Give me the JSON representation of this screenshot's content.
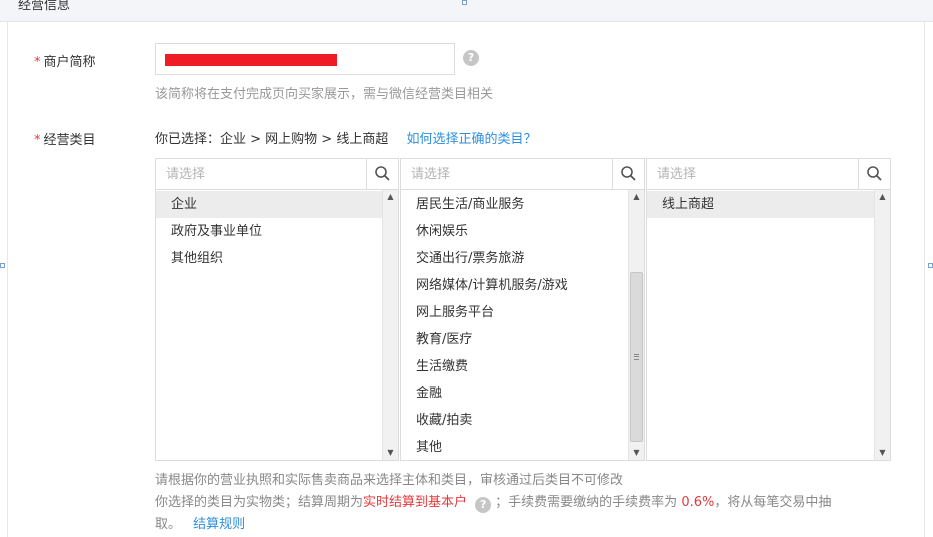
{
  "section": {
    "title": "经营信息"
  },
  "merchant_name": {
    "label": "商户简称",
    "required_mark": "*",
    "hint": "该简称将在支付完成页向买家展示，需与微信经营类目相关",
    "help": "?"
  },
  "category": {
    "label": "经营类目",
    "required_mark": "*",
    "selected_prefix": "你已选择：",
    "selected_path": "企业 > 网上购物 > 线上商超",
    "help_link": "如何选择正确的类目？",
    "columns": [
      {
        "placeholder": "请选择",
        "items": [
          "企业",
          "政府及事业单位",
          "其他组织"
        ],
        "selected": "企业"
      },
      {
        "placeholder": "请选择",
        "items": [
          "居民生活/商业服务",
          "休闲娱乐",
          "交通出行/票务旅游",
          "网络媒体/计算机服务/游戏",
          "网上服务平台",
          "教育/医疗",
          "生活缴费",
          "金融",
          "收藏/拍卖",
          "其他"
        ],
        "scroll_position": 0.75
      },
      {
        "placeholder": "请选择",
        "items": [
          "线上商超"
        ],
        "selected": "线上商超"
      }
    ],
    "note_line1": "请根据你的营业执照和实际售卖商品来选择主体和类目，审核通过后类目不可修改",
    "note_line2_a": "你选择的类目为实物类；结算周期为",
    "note_settlement": "实时结算到基本户",
    "note_line2_b": "；手续费需要缴纳的手续费率为",
    "note_rate": "0.6%",
    "note_line2_c": "，将从每笔交易中抽",
    "note_line3": "取。",
    "settlement_rules_link": "结算规则"
  },
  "icons": {
    "search": "search-icon",
    "help": "help-circle-icon"
  },
  "colors": {
    "link": "#2f8fdd",
    "required": "#e4393c",
    "selected_bg": "#ececec"
  }
}
